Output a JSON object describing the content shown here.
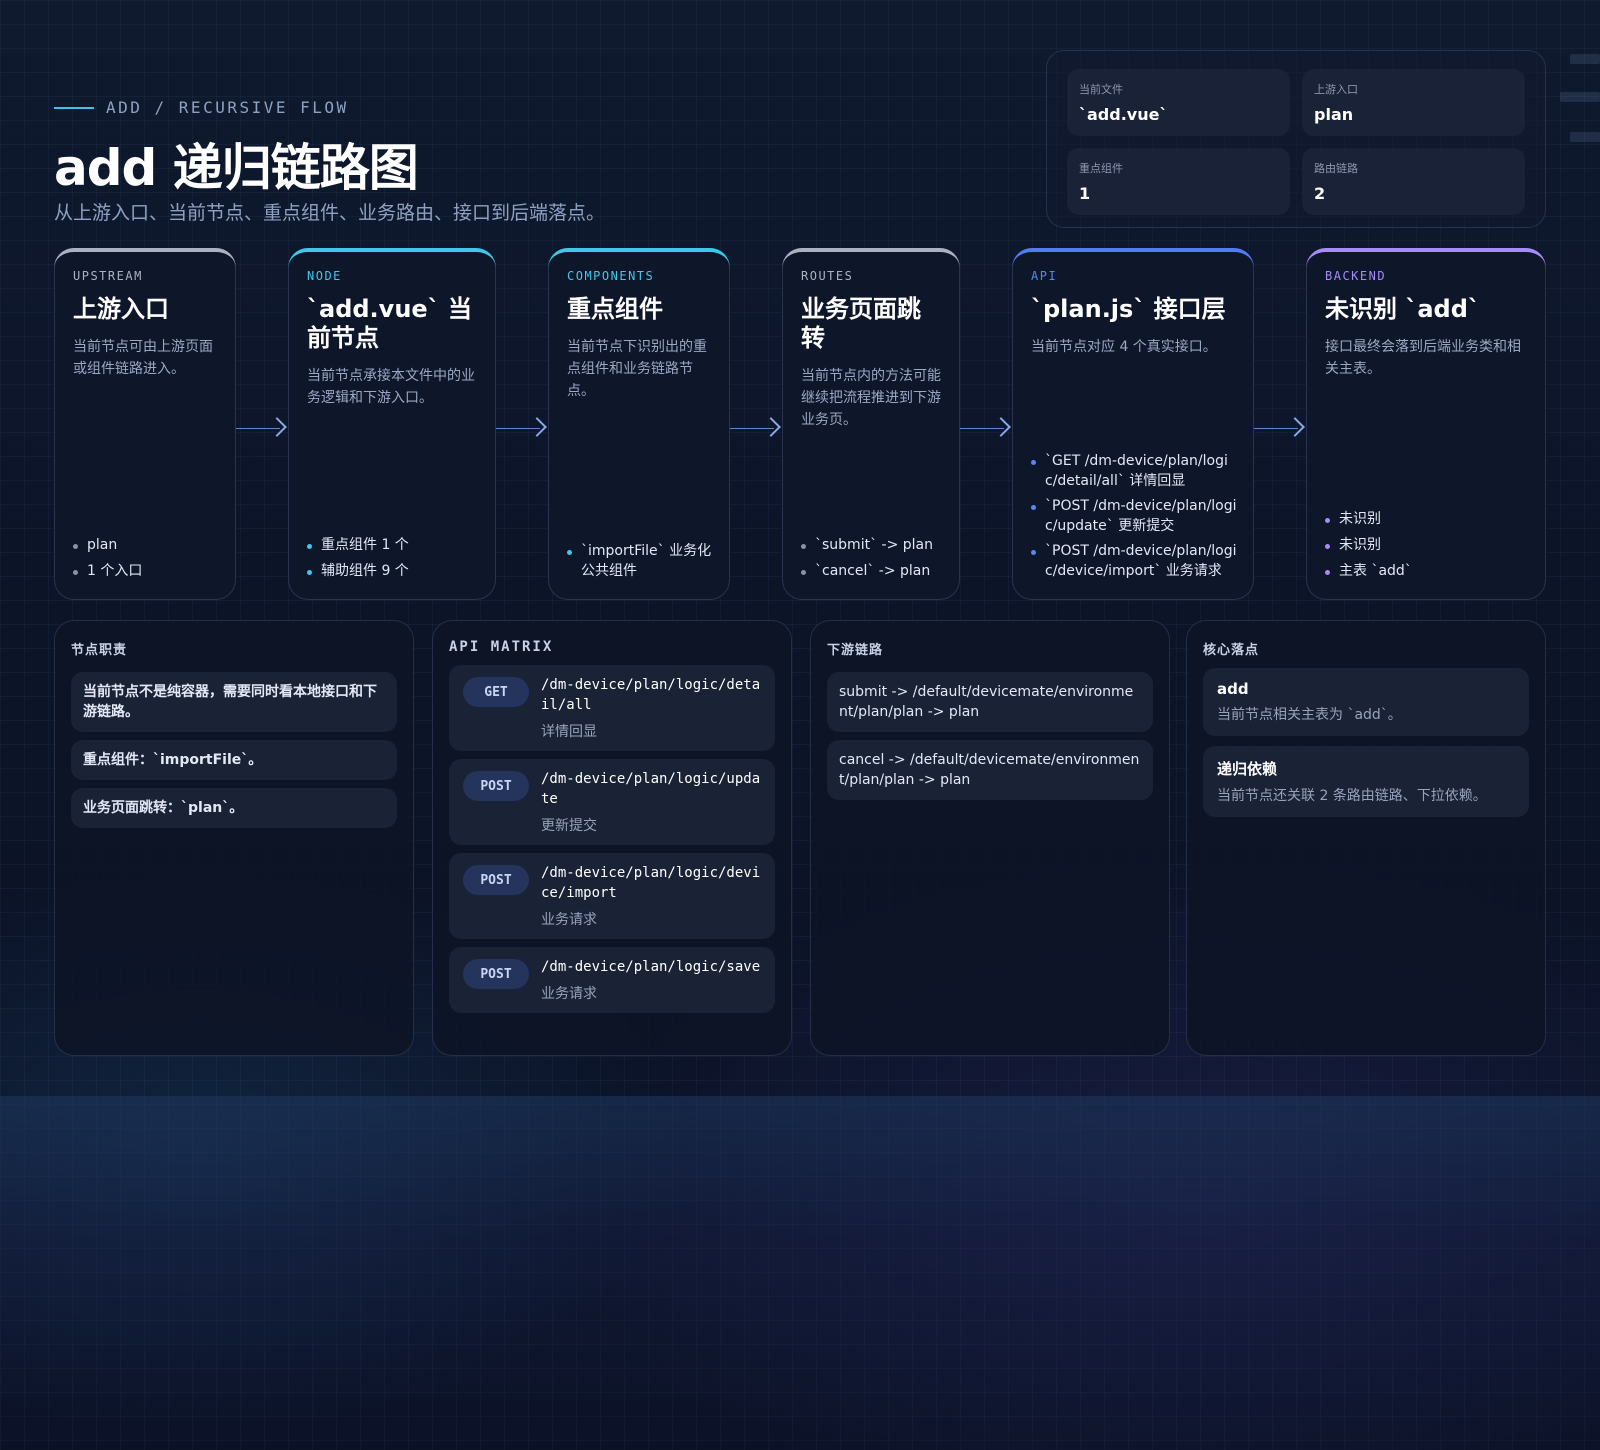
{
  "header": {
    "eyebrow": "ADD / RECURSIVE FLOW",
    "title": "add 递归链路图",
    "subtitle": "从上游入口、当前节点、重点组件、业务路由、接口到后端落点。"
  },
  "summary": [
    {
      "label": "当前文件",
      "value": "`add.vue`"
    },
    {
      "label": "上游入口",
      "value": "plan"
    },
    {
      "label": "重点组件",
      "value": "1"
    },
    {
      "label": "路由链路",
      "value": "2"
    }
  ],
  "flow": [
    {
      "tag": "UPSTREAM",
      "title": "上游入口",
      "desc": "当前节点可由上游页面或组件链路进入。",
      "bullets": [
        "plan",
        "1 个入口"
      ]
    },
    {
      "tag": "NODE",
      "title": "`add.vue` 当前节点",
      "desc": "当前节点承接本文件中的业务逻辑和下游入口。",
      "bullets": [
        "重点组件 1 个",
        "辅助组件 9 个"
      ]
    },
    {
      "tag": "COMPONENTS",
      "title": "重点组件",
      "desc": "当前节点下识别出的重点组件和业务链路节点。",
      "bullets": [
        "`importFile` 业务化公共组件"
      ]
    },
    {
      "tag": "ROUTES",
      "title": "业务页面跳转",
      "desc": "当前节点内的方法可能继续把流程推进到下游业务页。",
      "bullets": [
        "`submit` -> plan",
        "`cancel` -> plan"
      ]
    },
    {
      "tag": "API",
      "title": "`plan.js` 接口层",
      "desc": "当前节点对应 4 个真实接口。",
      "bullets": [
        "`GET /dm-device/plan/logic/detail/all` 详情回显",
        "`POST /dm-device/plan/logic/update` 更新提交",
        "`POST /dm-device/plan/logic/device/import` 业务请求"
      ]
    },
    {
      "tag": "BACKEND",
      "title": "未识别 `add`",
      "desc": "接口最终会落到后端业务类和相关主表。",
      "bullets": [
        "未识别",
        "未识别",
        "主表 `add`"
      ]
    }
  ],
  "responsibilities": {
    "title": "节点职责",
    "items": [
      "当前节点不是纯容器，需要同时看本地接口和下游链路。",
      "重点组件：`importFile`。",
      "业务页面跳转：`plan`。"
    ]
  },
  "api_matrix": {
    "title": "API MATRIX",
    "rows": [
      {
        "method": "GET",
        "path": "/dm-device/plan/logic/detail/all",
        "desc": "详情回显"
      },
      {
        "method": "POST",
        "path": "/dm-device/plan/logic/update",
        "desc": "更新提交"
      },
      {
        "method": "POST",
        "path": "/dm-device/plan/logic/device/import",
        "desc": "业务请求"
      },
      {
        "method": "POST",
        "path": "/dm-device/plan/logic/save",
        "desc": "业务请求"
      }
    ]
  },
  "downstream": {
    "title": "下游链路",
    "items": [
      "submit -> /default/devicemate/environment/plan/plan -> plan",
      "cancel -> /default/devicemate/environment/plan/plan -> plan"
    ]
  },
  "core": {
    "title": "核心落点",
    "items": [
      {
        "title": "add",
        "desc": "当前节点相关主表为 `add`。"
      },
      {
        "title": "递归依赖",
        "desc": "当前节点还关联 2 条路由链路、下拉依赖。"
      }
    ]
  },
  "colors": {
    "upstream": "#aab2c2",
    "node": "#3fc8ea",
    "components": "#3fc8ea",
    "routes": "#aab2c2",
    "api": "#4f7cf0",
    "backend": "#a78bfa"
  }
}
